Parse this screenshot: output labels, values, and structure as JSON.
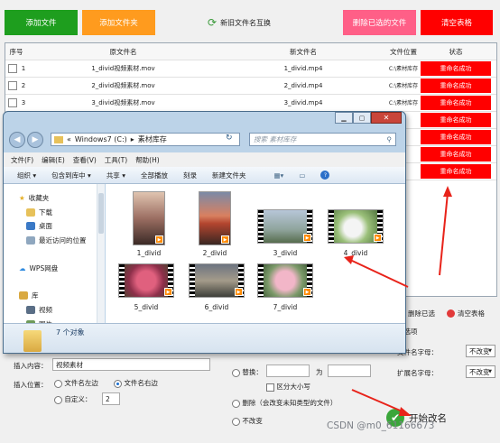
{
  "toolbar": {
    "add_files": "添加文件",
    "add_folder": "添加文件夹",
    "swap_names": "新旧文件名互换",
    "delete_selected": "删除已选的文件",
    "clear_table": "清空表格"
  },
  "columns": {
    "index": "序号",
    "original": "原文件名",
    "new": "新文件名",
    "location": "文件位置",
    "status": "状态"
  },
  "rows": [
    {
      "index": "1",
      "original": "1_divid视频素材.mov",
      "new": "1_divid.mp4",
      "location": "C:\\素材库存",
      "status": "重命名成功"
    },
    {
      "index": "2",
      "original": "2_divid视频素材.mov",
      "new": "2_divid.mp4",
      "location": "C:\\素材库存",
      "status": "重命名成功"
    },
    {
      "index": "3",
      "original": "3_divid视频素材.mov",
      "new": "3_divid.mp4",
      "location": "C:\\素材库存",
      "status": "重命名成功"
    }
  ],
  "status_extra": [
    "重命名成功",
    "重命名成功",
    "重命名成功",
    "重命名成功"
  ],
  "explorer": {
    "breadcrumb_prefix": "«",
    "breadcrumb_drive": "Windows7 (C:)",
    "breadcrumb_sep": "▸",
    "breadcrumb_folder": "素材库存",
    "search_placeholder": "搜索 素材库存",
    "menu": [
      "文件(F)",
      "编辑(E)",
      "查看(V)",
      "工具(T)",
      "帮助(H)"
    ],
    "commands": [
      "组织 ▾",
      "包含到库中 ▾",
      "共享 ▾",
      "全部播放",
      "刻录",
      "新建文件夹"
    ],
    "nav": {
      "favorites": "收藏夹",
      "downloads": "下载",
      "desktop": "桌面",
      "recent": "最近访问的位置",
      "wps": "WPS网盘",
      "library": "库",
      "videos": "视频",
      "pictures": "图片"
    },
    "files": [
      "1_divid",
      "2_divid",
      "3_divid",
      "4_divid",
      "5_divid",
      "6_divid",
      "7_divid"
    ],
    "status": "7 个对象"
  },
  "right": {
    "delete_selected": "删除已选",
    "clear_table": "清空表格",
    "other_options": "他选项",
    "ext_case_label": "文件名字母：",
    "ext_case_value": "不改变",
    "ext_name_label": "扩展名字母：",
    "ext_name_value": "不改变"
  },
  "bottom": {
    "insert_content_label": "插入内容：",
    "insert_content_value": "视频素材",
    "insert_pos_label": "插入位置：",
    "left": "文件名左边",
    "right": "文件名右边",
    "custom": "自定义：",
    "custom_value": "2",
    "replace": "替换：",
    "to": "为",
    "case": "区分大小写",
    "delete_option": "删除（会改变未知类型的文件）",
    "no_change": "不改变",
    "start": "开始改名"
  },
  "watermark": "CSDN @m0_61166673",
  "colors": {
    "green": "#1e9e1e",
    "orange": "#ff9b1e",
    "pink": "#ff5f87",
    "red": "#ff0000",
    "annotation": "#e8231a"
  }
}
